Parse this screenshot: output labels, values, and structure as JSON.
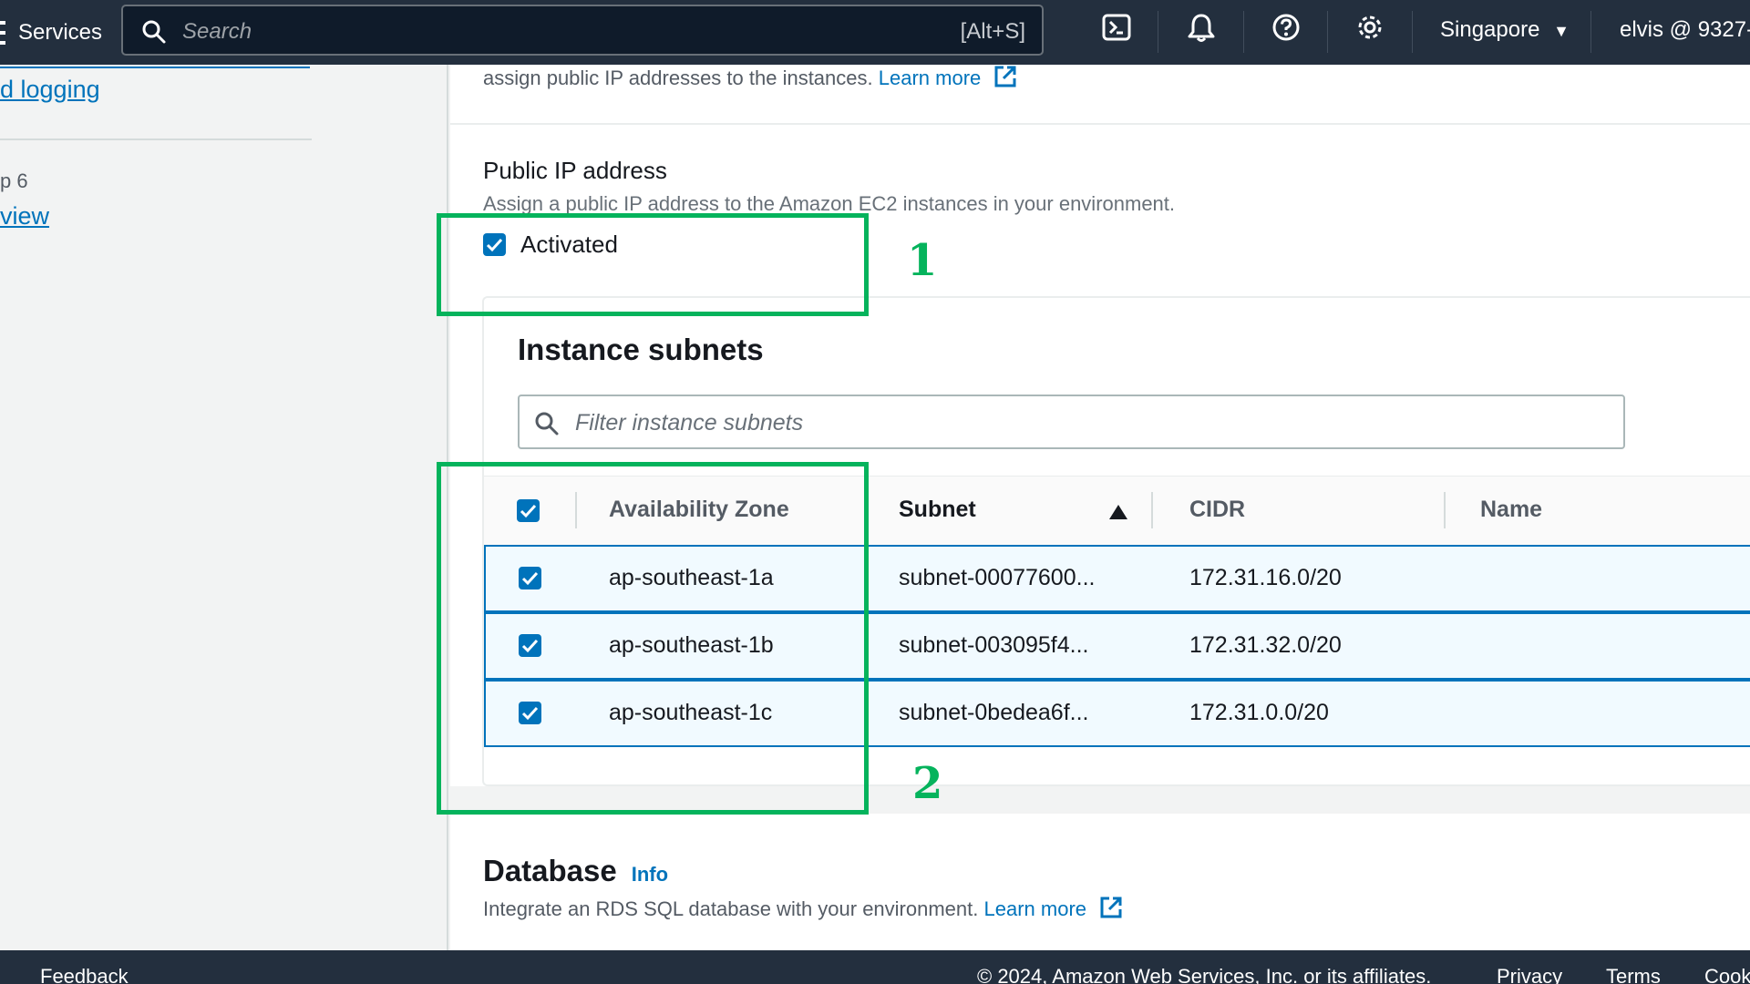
{
  "topnav": {
    "services_label": "Services",
    "search_placeholder": "Search",
    "search_shortcut": "[Alt+S]",
    "icons": [
      "cloudshell-icon",
      "bell-icon",
      "help-icon",
      "gear-icon"
    ],
    "region_label": "Singapore",
    "account_label": "elvis @ 9327-"
  },
  "sidenav": {
    "link_logging": "d logging",
    "step_label": "p 6",
    "link_review": "view"
  },
  "upper": {
    "text": "assign public IP addresses to the instances.",
    "learn_more": "Learn more"
  },
  "public_ip": {
    "label": "Public IP address",
    "description": "Assign a public IP address to the Amazon EC2 instances in your environment.",
    "checkbox_label": "Activated",
    "checked": true
  },
  "subnets": {
    "title": "Instance subnets",
    "filter_placeholder": "Filter instance subnets",
    "columns": [
      "Availability Zone",
      "Subnet",
      "CIDR",
      "Name"
    ],
    "sorted_column": "Subnet",
    "sort_direction": "ascending",
    "rows": [
      {
        "az": "ap-southeast-1a",
        "subnet": "subnet-00077600...",
        "cidr": "172.31.16.0/20",
        "name": "",
        "checked": true
      },
      {
        "az": "ap-southeast-1b",
        "subnet": "subnet-003095f4...",
        "cidr": "172.31.32.0/20",
        "name": "",
        "checked": true
      },
      {
        "az": "ap-southeast-1c",
        "subnet": "subnet-0bedea6f...",
        "cidr": "172.31.0.0/20",
        "name": "",
        "checked": true
      }
    ]
  },
  "database": {
    "title": "Database",
    "info_label": "Info",
    "description": "Integrate an RDS SQL database with your environment.",
    "learn_more": "Learn more"
  },
  "footer": {
    "feedback": "Feedback",
    "copyright": "© 2024, Amazon Web Services, Inc. or its affiliates.",
    "privacy": "Privacy",
    "terms": "Terms",
    "cookies": "Cook"
  },
  "annotations": {
    "label_1": "1",
    "label_2": "2",
    "color": "#05b35c"
  },
  "colors": {
    "nav_bg": "#232f3e",
    "link": "#0073bb",
    "selected_row_bg": "#f1faff"
  }
}
